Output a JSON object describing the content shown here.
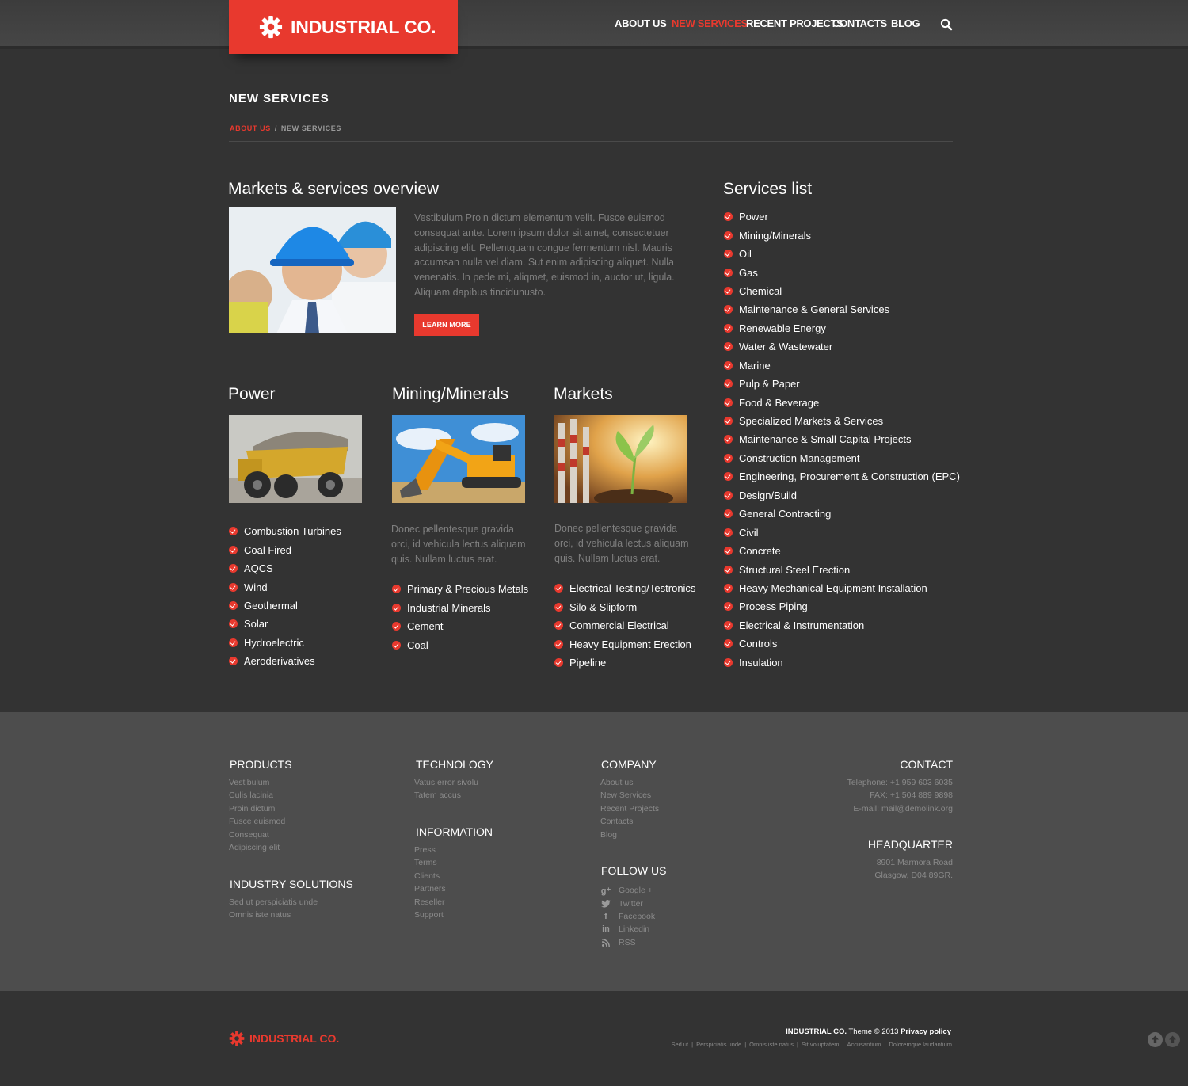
{
  "brand": {
    "name": "INDUSTRIAL CO.",
    "accent": "#e8392e"
  },
  "nav": {
    "items": [
      "ABOUT US",
      "NEW SERVICES",
      "RECENT PROJECTS",
      "CONTACTS",
      "BLOG"
    ],
    "active": "NEW SERVICES",
    "search_icon": "search-icon"
  },
  "page": {
    "title": "NEW SERVICES",
    "breadcrumb": [
      "ABOUT US",
      "NEW SERVICES"
    ]
  },
  "overview": {
    "heading": "Markets & services overview",
    "text": "Vestibulum Proin dictum elementum velit. Fusce euismod consequat ante. Lorem ipsum dolor sit amet, consectetuer adipiscing elit. Pellentquam congue fermentum nisl. Mauris accumsan nulla vel diam. Sut enim adipiscing aliquet. Nulla venenatis. In pede mi, aliqmet, euismod in, auctor ut, ligula. Aliquam dapibus tincidunusto.",
    "button": "LEARN MORE"
  },
  "columns": [
    {
      "heading": "Power",
      "text": "",
      "items": [
        "Combustion Turbines",
        "Coal Fired",
        "AQCS",
        "Wind",
        "Geothermal",
        "Solar",
        "Hydroelectric",
        "Aeroderivatives"
      ]
    },
    {
      "heading": "Mining/Minerals",
      "text": "Donec pellentesque gravida orci, id vehicula lectus aliquam quis. Nullam luctus erat.",
      "items": [
        "Primary & Precious Metals",
        "Industrial Minerals",
        "Cement",
        "Coal"
      ]
    },
    {
      "heading": "Markets",
      "text": "Donec pellentesque gravida orci, id vehicula lectus aliquam quis. Nullam luctus erat.",
      "items": [
        "Electrical Testing/Testronics",
        "Silo & Slipform",
        "Commercial Electrical",
        "Heavy Equipment Erection",
        "Pipeline"
      ]
    }
  ],
  "services": {
    "heading": "Services list",
    "items": [
      "Power",
      "Mining/Minerals",
      "Oil",
      "Gas",
      "Chemical",
      "Maintenance & General Services",
      "Renewable Energy",
      "Water & Wastewater",
      "Marine",
      "Pulp & Paper",
      "Food & Beverage",
      "Specialized Markets & Services",
      "Maintenance & Small Capital Projects",
      "Construction Management",
      "Engineering, Procurement & Construction (EPC)",
      "Design/Build",
      "General Contracting",
      "Civil",
      "Concrete",
      "Structural Steel Erection",
      "Heavy Mechanical Equipment Installation",
      "Process Piping",
      "Electrical & Instrumentation",
      "Controls",
      "Insulation"
    ]
  },
  "footer": {
    "products": {
      "heading": "PRODUCTS",
      "items": [
        "Vestibulum",
        "Culis lacinia",
        "Proin dictum",
        "Fusce euismod",
        "Consequat",
        "Adipiscing elit"
      ]
    },
    "industry": {
      "heading": "INDUSTRY SOLUTIONS",
      "items": [
        "Sed ut perspiciatis unde",
        "Omnis iste natus"
      ]
    },
    "technology": {
      "heading": "TECHNOLOGY",
      "items": [
        "Vatus error sivolu",
        "Tatem accus"
      ]
    },
    "information": {
      "heading": "INFORMATION",
      "items": [
        "Press",
        "Terms",
        "Clients",
        "Partners",
        "Reseller",
        "Support"
      ]
    },
    "company": {
      "heading": "COMPANY",
      "items": [
        "About us",
        "New Services",
        "Recent Projects",
        "Contacts",
        "Blog"
      ]
    },
    "follow": {
      "heading": "FOLLOW US",
      "items": [
        {
          "label": "Google +",
          "icon": "google-plus-icon"
        },
        {
          "label": "Twitter",
          "icon": "twitter-icon"
        },
        {
          "label": "Facebook",
          "icon": "facebook-icon"
        },
        {
          "label": "Linkedin",
          "icon": "linkedin-icon"
        },
        {
          "label": "RSS",
          "icon": "rss-icon"
        }
      ]
    },
    "contact": {
      "heading": "CONTACT",
      "items": [
        "Telephone:   +1 959 603 6035",
        "FAX:   +1 504 889 9898",
        "E-mail: mail@demolink.org"
      ]
    },
    "headquarter": {
      "heading": "HEADQUARTER",
      "items": [
        "8901 Marmora Road",
        "Glasgow, D04 89GR."
      ]
    }
  },
  "bottom": {
    "brand": "INDUSTRIAL CO.",
    "copyright_brand": "INDUSTRIAL CO.",
    "copyright_rest": " Theme © 2013 ",
    "privacy": "Privacy policy",
    "links": [
      "Sed ut",
      "Perspiciatis unde",
      "Omnis iste natus",
      "Sit voluptatem",
      "Accusantium",
      "Doloremque laudantium"
    ]
  }
}
